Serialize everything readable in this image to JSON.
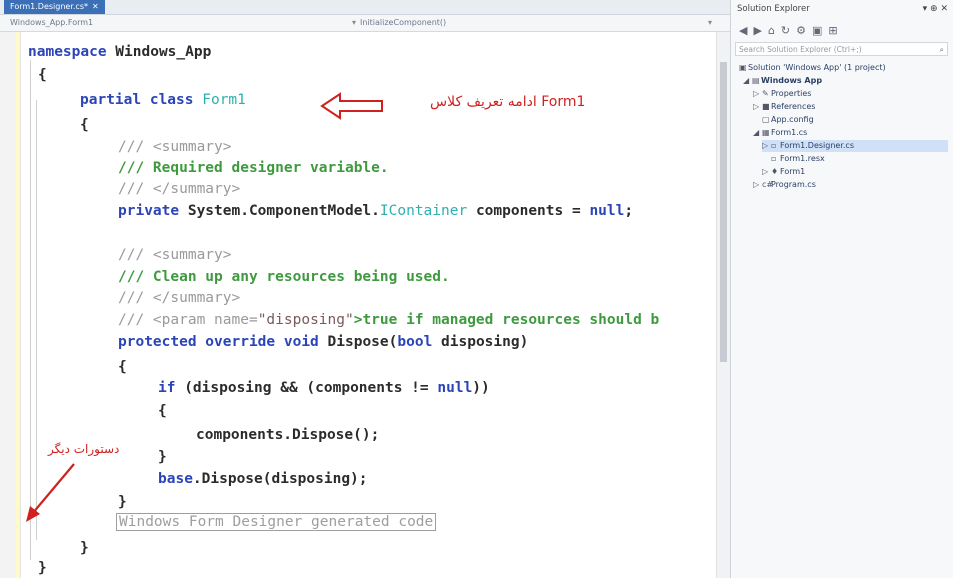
{
  "editor": {
    "tab_label": "Form1.Designer.cs*",
    "tab_close": "✕",
    "nav_left": "Windows_App.Form1",
    "nav_right": "InitializeComponent()",
    "code": {
      "l1_kw": "namespace",
      "l1_name": " Windows_App",
      "l2": "{",
      "l3_kw": "partial class",
      "l3_type": " Form1",
      "l4": "{",
      "l5_tag": "/// <summary>",
      "l6_text": "/// Required designer variable.",
      "l7_tag": "/// </summary>",
      "l8_kw": "private",
      "l8_a": " System.ComponentModel.",
      "l8_type": "IContainer",
      "l8_b": " components = ",
      "l8_null": "null",
      "l8_end": ";",
      "l9_tag": "/// <summary>",
      "l10_text": "/// Clean up any resources being used.",
      "l11_tag": "/// </summary>",
      "l12_a": "/// <param name=",
      "l12_str": "\"disposing\"",
      "l12_b": ">true if managed resources should b",
      "l13_kw": "protected override void",
      "l13_a": " Dispose(",
      "l13_kw2": "bool",
      "l13_b": " disposing)",
      "l14": "{",
      "l15_kw": "if",
      "l15_a": " (disposing && (components != ",
      "l15_null": "null",
      "l15_b": "))",
      "l16": "{",
      "l17": "components.Dispose();",
      "l18": "}",
      "l19_kw": "base",
      "l19_a": ".Dispose(disposing);",
      "l20": "}",
      "l21_region": "Windows Form Designer generated code",
      "l22": "}",
      "l23": "}"
    }
  },
  "annotations": {
    "class_label": "ادامه تعریف کلاس Form1",
    "other_label": "دستورات دیگر",
    "color": "#d02020"
  },
  "solution_explorer": {
    "title": "Solution Explorer",
    "pins": "▾ ⊕ ✕",
    "toolbar": [
      "◀",
      "▶",
      "⌂",
      "↻",
      "⚙",
      "▣",
      "⊞"
    ],
    "search_placeholder": "Search Solution Explorer (Ctrl+;)",
    "search_icon": "search-icon",
    "tree": {
      "solution": "Solution 'Windows App' (1 project)",
      "project": "Windows App",
      "properties": "Properties",
      "references": "References",
      "appconfig": "App.config",
      "form1cs": "Form1.cs",
      "designer": "Form1.Designer.cs",
      "resx": "Form1.resx",
      "form1": "Form1",
      "program": "Program.cs"
    }
  }
}
